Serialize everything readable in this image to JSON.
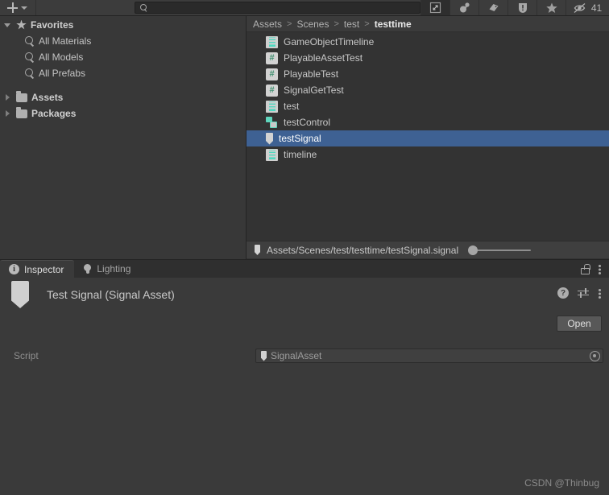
{
  "project_window": {
    "toolbar": {
      "create_label": "+",
      "create_icon": "plus-icon",
      "dropdown_icon": "chevron-down-icon",
      "search": {
        "value": "",
        "placeholder": "",
        "icon": "search-icon"
      },
      "buttons": [
        {
          "name": "layout-expand-icon",
          "label": ""
        },
        {
          "name": "account-icon",
          "label": ""
        },
        {
          "name": "tag-icon",
          "label": ""
        },
        {
          "name": "error-icon",
          "label": ""
        },
        {
          "name": "favorite-star-icon",
          "label": ""
        }
      ],
      "hidden_count": "41",
      "hidden_count_icon": "eye-slash-icon"
    },
    "tree": [
      {
        "label": "Favorites",
        "icon": "star-icon",
        "twirl": "open",
        "indent": 0,
        "bold": true
      },
      {
        "label": "All Materials",
        "icon": "search-icon",
        "twirl": "none",
        "indent": 1,
        "bold": false
      },
      {
        "label": "All Models",
        "icon": "search-icon",
        "twirl": "none",
        "indent": 1,
        "bold": false
      },
      {
        "label": "All Prefabs",
        "icon": "search-icon",
        "twirl": "none",
        "indent": 1,
        "bold": false
      },
      {
        "label": "Assets",
        "icon": "folder-icon",
        "twirl": "closed",
        "indent": 0,
        "bold": true
      },
      {
        "label": "Packages",
        "icon": "folder-icon",
        "twirl": "closed",
        "indent": 0,
        "bold": true
      }
    ],
    "breadcrumb": [
      "Assets",
      "Scenes",
      "test",
      "testtime"
    ],
    "breadcrumb_separator": ">",
    "files": [
      {
        "label": "GameObjectTimeline",
        "icon": "timeline-asset-icon",
        "selected": false
      },
      {
        "label": "PlayableAssetTest",
        "icon": "csharp-script-icon",
        "selected": false
      },
      {
        "label": "PlayableTest",
        "icon": "csharp-script-icon",
        "selected": false
      },
      {
        "label": "SignalGetTest",
        "icon": "csharp-script-icon",
        "selected": false
      },
      {
        "label": "test",
        "icon": "timeline-asset-icon",
        "selected": false
      },
      {
        "label": "testControl",
        "icon": "control-track-icon",
        "selected": false
      },
      {
        "label": "testSignal",
        "icon": "signal-asset-icon",
        "selected": true
      },
      {
        "label": "timeline",
        "icon": "timeline-asset-icon",
        "selected": false
      }
    ],
    "footer": {
      "path": "Assets/Scenes/test/testtime/testSignal.signal",
      "icon": "signal-asset-icon",
      "zoom_value": 0
    }
  },
  "inspector": {
    "tabs": [
      {
        "label": "Inspector",
        "icon": "info-icon",
        "active": true
      },
      {
        "label": "Lighting",
        "icon": "lightbulb-icon",
        "active": false
      }
    ],
    "tabbar_actions": [
      {
        "name": "lock-icon"
      },
      {
        "name": "more-options-icon"
      }
    ],
    "header": {
      "title": "Test Signal (Signal Asset)",
      "icon": "signal-asset-icon",
      "actions": [
        {
          "name": "help-icon",
          "label": "?"
        },
        {
          "name": "preset-icon"
        },
        {
          "name": "more-options-icon"
        }
      ]
    },
    "open_button": "Open",
    "fields": [
      {
        "label": "Script",
        "value": "SignalAsset",
        "value_icon": "signal-asset-icon",
        "picker_icon": "object-picker-icon"
      }
    ]
  },
  "watermark": "CSDN @Thinbug",
  "colors": {
    "selection_blue": "#3e6193",
    "panel_bg": "#383838",
    "panel_bg_alt": "#333333",
    "inspector_bg": "#3a3a3a",
    "accent_teal": "#4fd8c0",
    "text": "#c4c4c4"
  }
}
